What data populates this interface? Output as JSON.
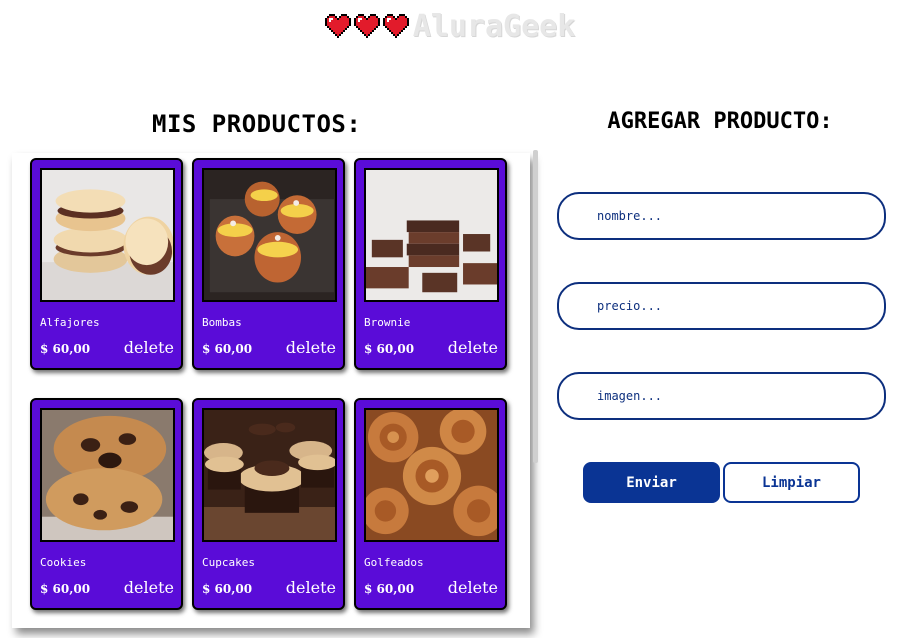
{
  "header": {
    "logo_text": "AluraGeek"
  },
  "products": {
    "title": "MIS PRODUCTOS:",
    "delete_label": "delete",
    "items": [
      {
        "name": "Alfajores",
        "price": "$ 60,00"
      },
      {
        "name": "Bombas",
        "price": "$ 60,00"
      },
      {
        "name": "Brownie",
        "price": "$ 60,00"
      },
      {
        "name": "Cookies",
        "price": "$ 60,00"
      },
      {
        "name": "Cupcakes",
        "price": "$ 60,00"
      },
      {
        "name": "Golfeados",
        "price": "$ 60,00"
      }
    ]
  },
  "form": {
    "title": "AGREGAR PRODUCTO:",
    "name_placeholder": "nombre...",
    "price_placeholder": "precio...",
    "image_placeholder": "imagen...",
    "name_value": "",
    "price_value": "",
    "image_value": "",
    "send_label": "Enviar",
    "clear_label": "Limpiar"
  },
  "colors": {
    "card_bg": "#5a0cd8",
    "primary_blue": "#0a3494",
    "heart_red": "#e21b2b"
  }
}
